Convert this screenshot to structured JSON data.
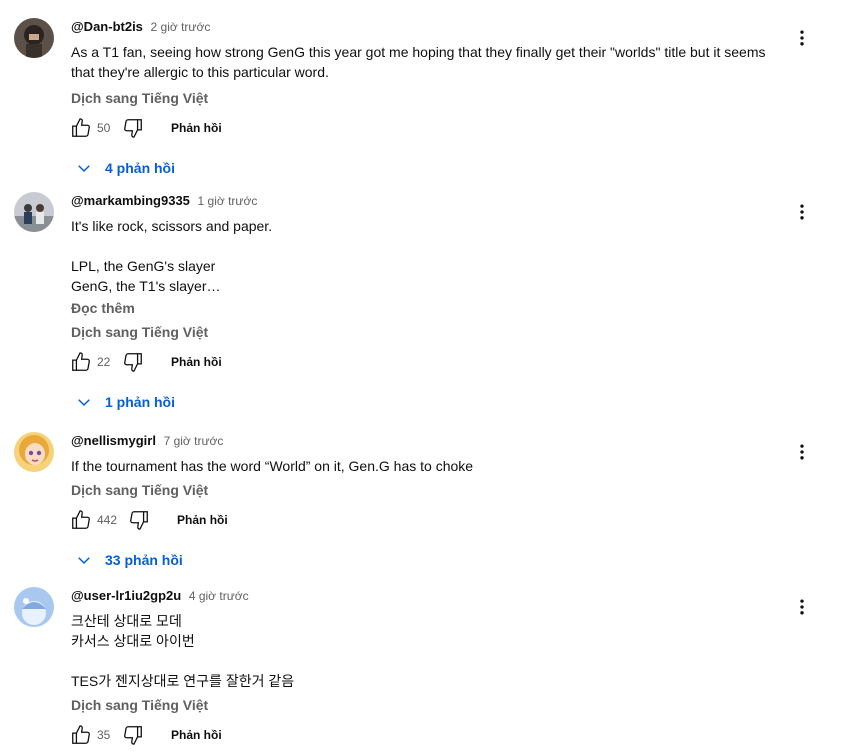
{
  "comments": [
    {
      "author": "@Dan-bt2is",
      "time": "2 giờ trước",
      "text": "As a T1 fan, seeing how strong GenG this year got me hoping that they finally get their \"worlds\" title but it seems that they're allergic to this particular word.",
      "translate": "Dịch sang Tiếng Việt",
      "likes": "50",
      "reply_label": "Phản hồi",
      "replies_label": "4 phản hồi"
    },
    {
      "author": "@markambing9335",
      "time": "1 giờ trước",
      "text": "It's like rock, scissors and paper.\n\nLPL, the GenG's slayer\nGenG, the T1's slayer…",
      "read_more": "Đọc thêm",
      "translate": "Dịch sang Tiếng Việt",
      "likes": "22",
      "reply_label": "Phản hồi",
      "replies_label": "1 phản hồi"
    },
    {
      "author": "@nellismygirl",
      "time": "7 giờ trước",
      "text": "If the tournament has the word “World” on it, Gen.G has to choke",
      "translate": "Dịch sang Tiếng Việt",
      "likes": "442",
      "reply_label": "Phản hồi",
      "replies_label": "33 phản hồi"
    },
    {
      "author": "@user-lr1iu2gp2u",
      "time": "4 giờ trước",
      "text": "크산테 상대로 모데\n카서스 상대로 아이번\n\nTES가 젠지상대로 연구를 잘한거 같음",
      "translate": "Dịch sang Tiếng Việt",
      "likes": "35",
      "reply_label": "Phản hồi"
    }
  ],
  "icons": {
    "like": "thumbs-up-icon",
    "dislike": "thumbs-down-icon",
    "more": "more-vertical-icon",
    "chevron": "chevron-down-icon"
  },
  "colors": {
    "accent": "#065fd4",
    "secondary_text": "#606060",
    "primary_text": "#0f0f0f"
  }
}
